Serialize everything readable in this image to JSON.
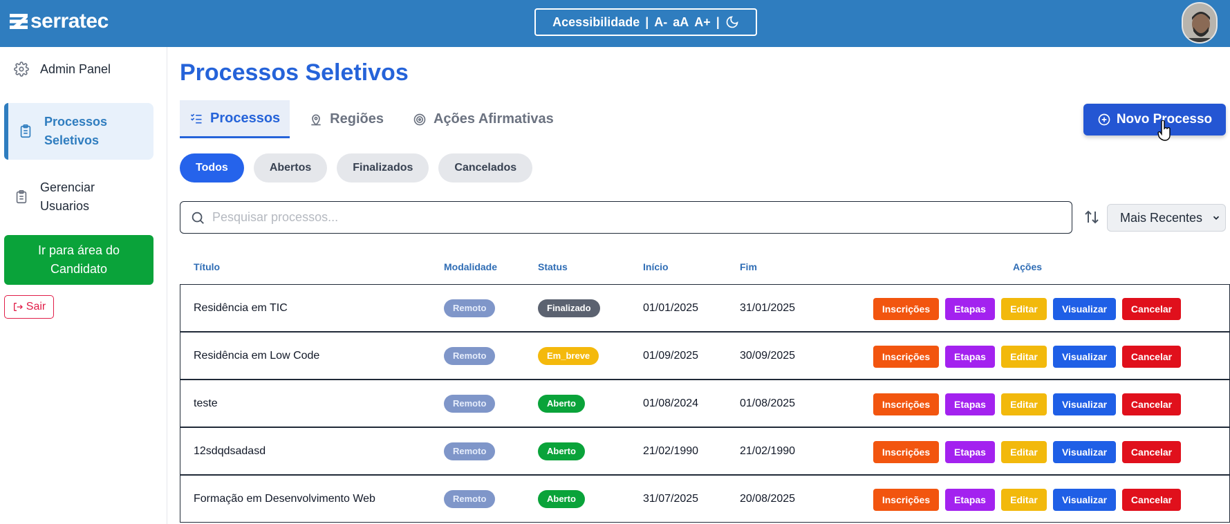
{
  "header": {
    "logo_text": "serratec",
    "accessibility": {
      "label": "Acessibilidade",
      "decrease": "A-",
      "reset": "aA",
      "increase": "A+",
      "dark_mode_icon": "moon-icon"
    }
  },
  "sidebar": {
    "items": [
      {
        "label": "Admin Panel",
        "icon": "gear-icon"
      },
      {
        "label": "Processos Seletivos",
        "icon": "clipboard-icon",
        "active": true
      },
      {
        "label": "Gerenciar Usuarios",
        "icon": "clipboard-list-icon"
      }
    ],
    "candidate_button": "Ir para área do Candidato",
    "logout": "Sair"
  },
  "main": {
    "title": "Processos Seletivos",
    "tabs": [
      {
        "label": "Processos",
        "icon": "list-check-icon",
        "active": true
      },
      {
        "label": "Regiões",
        "icon": "map-pin-icon"
      },
      {
        "label": "Ações Afirmativas",
        "icon": "target-icon"
      }
    ],
    "new_button": "Novo Processo",
    "filters": [
      {
        "label": "Todos",
        "active": true
      },
      {
        "label": "Abertos"
      },
      {
        "label": "Finalizados"
      },
      {
        "label": "Cancelados"
      }
    ],
    "search_placeholder": "Pesquisar processos...",
    "sort_value": "Mais Recentes",
    "columns": {
      "title": "Título",
      "modality": "Modalidade",
      "status": "Status",
      "start": "Início",
      "end": "Fim",
      "actions": "Ações"
    },
    "action_labels": {
      "inscricoes": "Inscrições",
      "etapas": "Etapas",
      "editar": "Editar",
      "visualizar": "Visualizar",
      "cancelar": "Cancelar"
    },
    "rows": [
      {
        "title": "Residência em TIC",
        "modality": "Remoto",
        "status": "Finalizado",
        "start": "01/01/2025",
        "end": "31/01/2025"
      },
      {
        "title": "Residência em Low Code",
        "modality": "Remoto",
        "status": "Em_breve",
        "start": "01/09/2025",
        "end": "30/09/2025"
      },
      {
        "title": "teste",
        "modality": "Remoto",
        "status": "Aberto",
        "start": "01/08/2024",
        "end": "01/08/2025"
      },
      {
        "title": "12sdqdsadasd",
        "modality": "Remoto",
        "status": "Aberto",
        "start": "21/02/1990",
        "end": "21/02/1990"
      },
      {
        "title": "Formação em Desenvolvimento Web",
        "modality": "Remoto",
        "status": "Aberto",
        "start": "31/07/2025",
        "end": "20/08/2025"
      }
    ]
  },
  "colors": {
    "header_bg": "#2f7dbf",
    "primary": "#2563d9",
    "success": "#0aa33a",
    "danger": "#e0101c"
  }
}
